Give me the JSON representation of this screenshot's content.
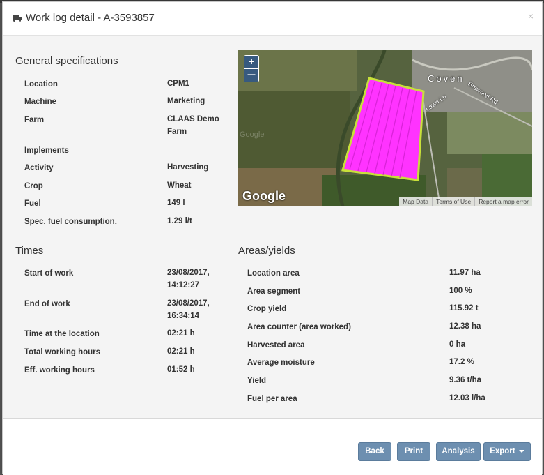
{
  "modal": {
    "title": "Work log detail - A-3593857",
    "close_label": "×"
  },
  "general": {
    "title": "General specifications",
    "rows": [
      {
        "label": "Location",
        "value": "CPM1"
      },
      {
        "label": "Machine",
        "value": "Marketing"
      },
      {
        "label": "Farm",
        "value": "CLAAS Demo Farm"
      },
      {
        "label": "Implements",
        "value": ""
      },
      {
        "label": "Activity",
        "value": "Harvesting"
      },
      {
        "label": "Crop",
        "value": "Wheat"
      },
      {
        "label": "Fuel",
        "value": "149 l"
      },
      {
        "label": "Spec. fuel consumption.",
        "value": "1.29 l/t"
      }
    ]
  },
  "times": {
    "title": "Times",
    "rows": [
      {
        "label": "Start of work",
        "value": "23/08/2017, 14:12:27"
      },
      {
        "label": "End of work",
        "value": "23/08/2017, 16:34:14"
      },
      {
        "label": "Time at the location",
        "value": "02:21 h"
      },
      {
        "label": "Total working hours",
        "value": "02:21 h"
      },
      {
        "label": "Eff. working hours",
        "value": "01:52 h"
      }
    ]
  },
  "areas": {
    "title": "Areas/yields",
    "rows": [
      {
        "label": "Location area",
        "value": "11.97 ha"
      },
      {
        "label": "Area segment",
        "value": "100 %"
      },
      {
        "label": "Crop yield",
        "value": "115.92 t"
      },
      {
        "label": "Area counter (area worked)",
        "value": "12.38 ha"
      },
      {
        "label": "Harvested area",
        "value": "0 ha"
      },
      {
        "label": "Average moisture",
        "value": "17.2 %"
      },
      {
        "label": "Yield",
        "value": "9.36 t/ha"
      },
      {
        "label": "Fuel per area",
        "value": "12.03 l/ha"
      }
    ]
  },
  "map": {
    "zoom_in": "+",
    "zoom_out": "—",
    "logo": "Google",
    "watermark": "Google",
    "place_label": "Coven",
    "road_1": "Brewood Rd",
    "road_2": "Lawn Ln",
    "footer": [
      "Map Data",
      "Terms of Use",
      "Report a map error"
    ],
    "field_color": "#ff33ff",
    "field_border": "#c8e03a"
  },
  "buttons": {
    "back": "Back",
    "print": "Print",
    "analysis": "Analysis",
    "export": "Export"
  }
}
